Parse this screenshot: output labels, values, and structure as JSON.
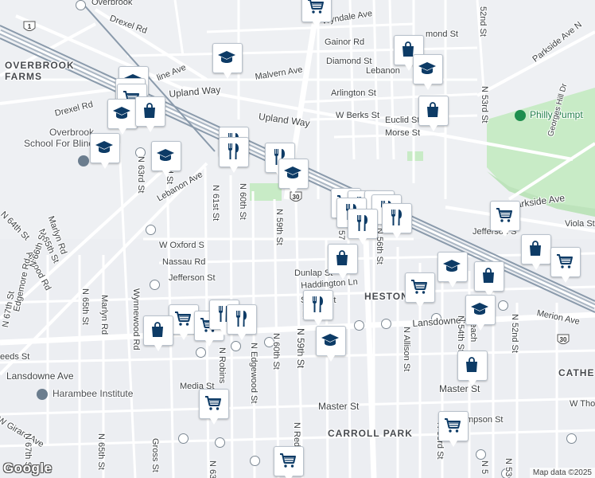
{
  "map": {
    "area_labels": [
      {
        "id": "overbrook-farms",
        "text": "OVERBROOK\nFARMS"
      },
      {
        "id": "heston",
        "text": "HESTON"
      },
      {
        "id": "carroll-park",
        "text": "CARROLL PARK"
      },
      {
        "id": "cathe",
        "text": "CATHE"
      }
    ],
    "poi_labels": [
      {
        "id": "overbrook-school",
        "text": "Overbrook\nSchool For Blind"
      },
      {
        "id": "harambee-institute",
        "text": "Harambee Institute"
      },
      {
        "id": "philly-pumpt",
        "text": "Philly Pumpt"
      }
    ],
    "street_labels": [
      {
        "id": "overbrook",
        "text": "Overbrook"
      },
      {
        "id": "drexel-rd-top",
        "text": "Drexel Rd"
      },
      {
        "id": "drexel-rd",
        "text": "Drexel Rd"
      },
      {
        "id": "wyndale",
        "text": "Wyndale Ave"
      },
      {
        "id": "gainor",
        "text": "Gainor Rd"
      },
      {
        "id": "diamond",
        "text": "Diamond St"
      },
      {
        "id": "malvern",
        "text": "Malvern Ave"
      },
      {
        "id": "lebanon-top",
        "text": "Lebanon"
      },
      {
        "id": "mond",
        "text": "mond St"
      },
      {
        "id": "52nd-top",
        "text": "52nd St"
      },
      {
        "id": "parkside-n",
        "text": "Parkside Ave N"
      },
      {
        "id": "line-ave",
        "text": "line Ave"
      },
      {
        "id": "upland-left",
        "text": "Upland Way"
      },
      {
        "id": "upland-right",
        "text": "Upland Way"
      },
      {
        "id": "arlington",
        "text": "Arlington St"
      },
      {
        "id": "w-berks",
        "text": "W Berks St"
      },
      {
        "id": "euclid",
        "text": "Euclid St"
      },
      {
        "id": "morse",
        "text": "Morse St"
      },
      {
        "id": "53rd-top",
        "text": "N 53rd St"
      },
      {
        "id": "georges-hill",
        "text": "Georges Hill Dr"
      },
      {
        "id": "n-63rd",
        "text": "N 63rd St"
      },
      {
        "id": "rd-st",
        "text": "rd St"
      },
      {
        "id": "lebanon-ave",
        "text": "Lebanon Ave"
      },
      {
        "id": "n-61st",
        "text": "N 61st St"
      },
      {
        "id": "n-60th-top",
        "text": "N 60th St"
      },
      {
        "id": "n-59th-top",
        "text": "N 59th St"
      },
      {
        "id": "n-57",
        "text": "N 57"
      },
      {
        "id": "n-56th",
        "text": "N 56th St"
      },
      {
        "id": "parkside-ave",
        "text": "Parkside Ave"
      },
      {
        "id": "viola",
        "text": "Viola St"
      },
      {
        "id": "jefferson-right",
        "text": "Jefferson S"
      },
      {
        "id": "n-64th",
        "text": "N 64th St"
      },
      {
        "id": "marlyn-rd-top",
        "text": "Marlyn Rd"
      },
      {
        "id": "n-65th-top",
        "text": "N 65th St"
      },
      {
        "id": "atwood",
        "text": "Atwood Rd"
      },
      {
        "id": "n-66th",
        "text": "N 66th St"
      },
      {
        "id": "edgemore",
        "text": "Edgemore Rd"
      },
      {
        "id": "n-67th",
        "text": "N 67th St"
      },
      {
        "id": "w-oxford",
        "text": "W Oxford S"
      },
      {
        "id": "nassau",
        "text": "Nassau Rd"
      },
      {
        "id": "jefferson-left",
        "text": "Jefferson St"
      },
      {
        "id": "dunlap",
        "text": "Dunlap St"
      },
      {
        "id": "haddington",
        "text": "Haddington Ln"
      },
      {
        "id": "s-st",
        "text": "S"
      },
      {
        "id": "st-frag",
        "text": "St"
      },
      {
        "id": "he-frag",
        "text": "He"
      },
      {
        "id": "merion",
        "text": "Merion Ave"
      },
      {
        "id": "n-65th",
        "text": "N 65th St"
      },
      {
        "id": "marlyn-rd",
        "text": "Marlyn Rd"
      },
      {
        "id": "wynnewood",
        "text": "Wynnewood Rd"
      },
      {
        "id": "lansdowne-right",
        "text": "Lansdowne Ave"
      },
      {
        "id": "n-robins",
        "text": "N Robins"
      },
      {
        "id": "n-edgewood",
        "text": "N Edgewood St"
      },
      {
        "id": "n-60th",
        "text": "N 60th St"
      },
      {
        "id": "n-59th",
        "text": "N 59th St"
      },
      {
        "id": "n-allison",
        "text": "N Allison St"
      },
      {
        "id": "n-54th",
        "text": "N 54th St"
      },
      {
        "id": "peach",
        "text": "Peach"
      },
      {
        "id": "n-52nd",
        "text": "N 52nd St"
      },
      {
        "id": "eeds",
        "text": "eeds St"
      },
      {
        "id": "lansdowne-left",
        "text": "Lansdowne Ave"
      },
      {
        "id": "media",
        "text": "Media St"
      },
      {
        "id": "master-left",
        "text": "Master St"
      },
      {
        "id": "master-right",
        "text": "Master St"
      },
      {
        "id": "w-tho",
        "text": "W Tho"
      },
      {
        "id": "mpson",
        "text": "mpson St"
      },
      {
        "id": "n-redf",
        "text": "N Red"
      },
      {
        "id": "n-53rd",
        "text": "N 53rd St"
      },
      {
        "id": "w-girard",
        "text": "W Girard Ave"
      },
      {
        "id": "n-67th-bottom",
        "text": "N 67th St"
      },
      {
        "id": "n-65th-bottom",
        "text": "N 65th St"
      },
      {
        "id": "gross",
        "text": "Gross St"
      },
      {
        "id": "n-63-bottom",
        "text": "N 63"
      },
      {
        "id": "n-53-bottom",
        "text": "N 53"
      },
      {
        "id": "n-5-bottom",
        "text": "N 5"
      }
    ],
    "route_shields": [
      "1",
      "30",
      "30"
    ],
    "markers": [
      {
        "type": "shopping-cart"
      },
      {
        "type": "education"
      },
      {
        "type": "shopping-bag"
      },
      {
        "type": "education"
      },
      {
        "type": "education"
      },
      {
        "type": "education"
      },
      {
        "type": "shopping-cart"
      },
      {
        "type": "education"
      },
      {
        "type": "shopping-bag"
      },
      {
        "type": "education"
      },
      {
        "type": "education"
      },
      {
        "type": "restaurant"
      },
      {
        "type": "restaurant"
      },
      {
        "type": "restaurant"
      },
      {
        "type": "education"
      },
      {
        "type": "shopping-cart"
      },
      {
        "type": "restaurant"
      },
      {
        "type": "restaurant"
      },
      {
        "type": "restaurant"
      },
      {
        "type": "restaurant"
      },
      {
        "type": "restaurant"
      },
      {
        "type": "restaurant"
      },
      {
        "type": "shopping-cart"
      },
      {
        "type": "shopping-bag"
      },
      {
        "type": "shopping-cart"
      },
      {
        "type": "shopping-bag"
      },
      {
        "type": "shopping-bag"
      },
      {
        "type": "education"
      },
      {
        "type": "shopping-bag"
      },
      {
        "type": "shopping-cart"
      },
      {
        "type": "education"
      },
      {
        "type": "restaurant"
      },
      {
        "type": "education"
      },
      {
        "type": "shopping-cart"
      },
      {
        "type": "shopping-cart"
      },
      {
        "type": "restaurant"
      },
      {
        "type": "restaurant"
      },
      {
        "type": "shopping-bag"
      },
      {
        "type": "shopping-bag"
      },
      {
        "type": "shopping-cart"
      },
      {
        "type": "shopping-cart"
      },
      {
        "type": "shopping-cart"
      }
    ],
    "attribution": "Map data ©2025",
    "logo": "Google",
    "colors": {
      "marker_icon": "#0d3b66",
      "park": "#c8ebc6",
      "rail": "#8a9aab",
      "highway": "#a9b5c2"
    }
  }
}
